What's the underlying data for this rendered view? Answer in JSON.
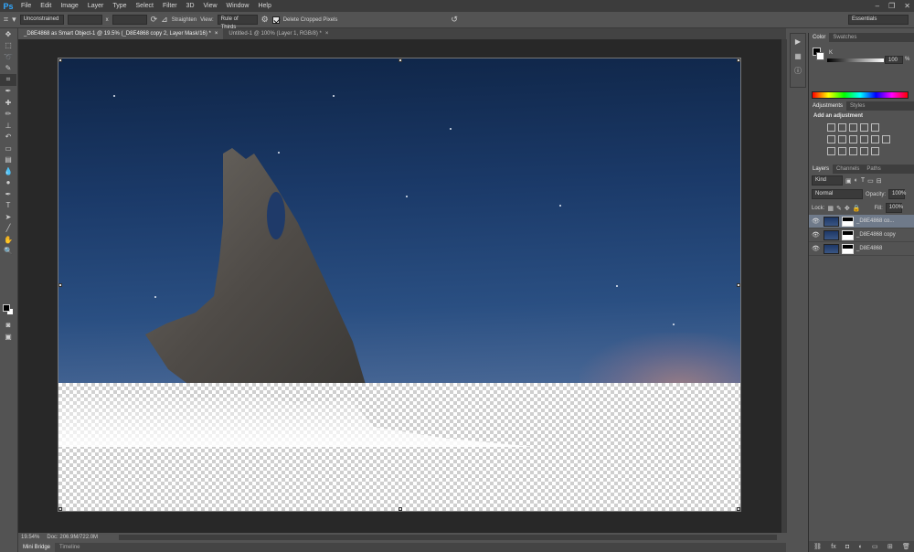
{
  "app": {
    "logo": "Ps"
  },
  "menu": [
    "File",
    "Edit",
    "Image",
    "Layer",
    "Type",
    "Select",
    "Filter",
    "3D",
    "View",
    "Window",
    "Help"
  ],
  "window_controls": {
    "minimize": "–",
    "restore": "❐",
    "close": "✕"
  },
  "options": {
    "ratio": "Unconstrained",
    "x_label": "x",
    "straighten": "Straighten",
    "view_label": "View:",
    "view_value": "Rule of Thirds",
    "delete_cropped": "Delete Cropped Pixels",
    "workspace": "Essentials"
  },
  "tabs": [
    {
      "label": "_D8E4868 as Smart Object-1 @ 19.5% (_D8E4868 copy 2, Layer Mask/16) *"
    },
    {
      "label": "Untitled-1 @ 100% (Layer 1, RGB/8) *"
    }
  ],
  "status": {
    "zoom": "19.54%",
    "doc": "Doc: 206.9M/722.0M"
  },
  "bottom_tabs": [
    "Mini Bridge",
    "Timeline"
  ],
  "panels": {
    "color_tabs": [
      "Color",
      "Swatches"
    ],
    "color_channel": "K",
    "color_value": "100",
    "color_unit": "%",
    "adj_tabs": [
      "Adjustments",
      "Styles"
    ],
    "adj_title": "Add an adjustment",
    "layer_tabs": [
      "Layers",
      "Channels",
      "Paths"
    ],
    "kind": "Kind",
    "blend": "Normal",
    "opacity_label": "Opacity:",
    "opacity": "100%",
    "lock_label": "Lock:",
    "fill_label": "Fill:",
    "fill": "100%",
    "layers": [
      {
        "name": "_D8E4868 co..."
      },
      {
        "name": "_D8E4868 copy"
      },
      {
        "name": "_D8E4868"
      }
    ]
  }
}
